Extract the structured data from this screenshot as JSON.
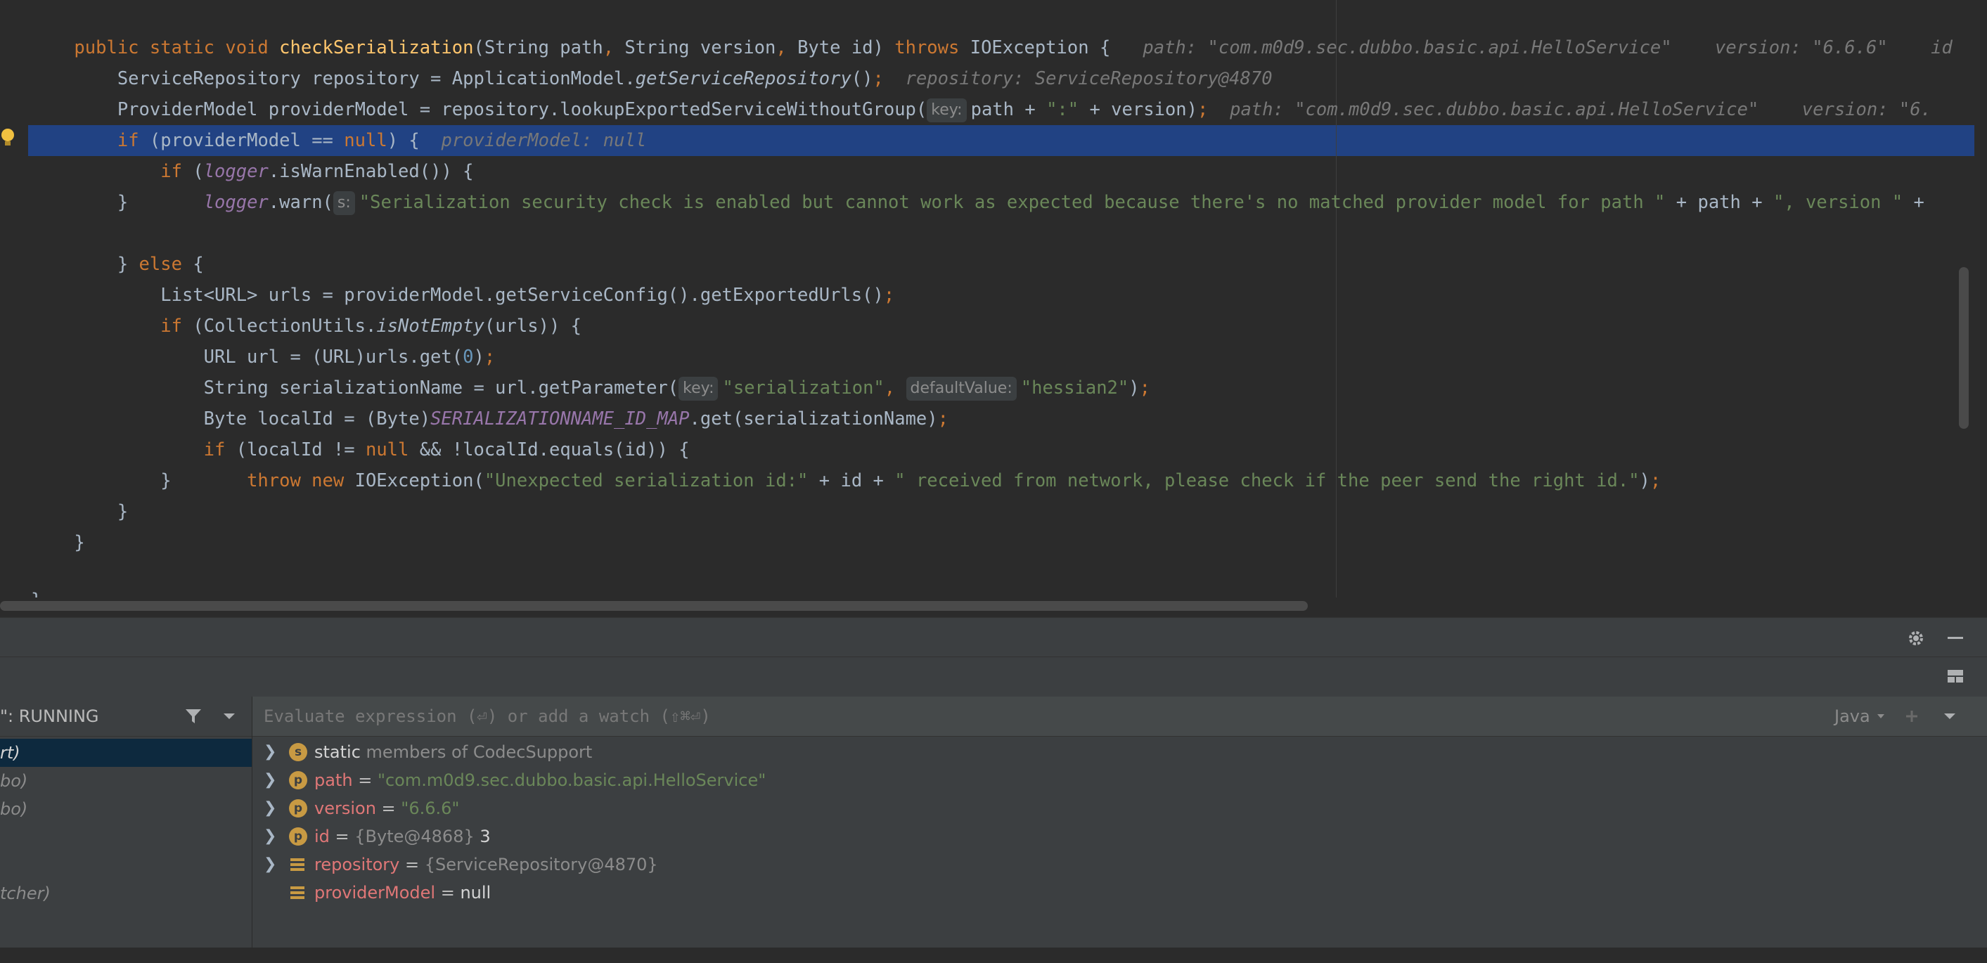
{
  "editor": {
    "lines": [
      {
        "id": "l1"
      },
      {
        "id": "l2"
      }
    ],
    "code": {
      "l1_a": "public static void ",
      "l1_fn": "checkSerialization",
      "l1_b": "(String path",
      "l1_c": ", ",
      "l1_d": "String version",
      "l1_e": ", ",
      "l1_f": "Byte id) ",
      "l1_g": "throws ",
      "l1_h": "IOException {",
      "l1_hint": "path: \"com.m0d9.sec.dubbo.basic.api.HelloService\"    version: \"6.6.6\"    id",
      "l2_a": "    ServiceRepository repository = ApplicationModel.",
      "l2_b": "getServiceRepository",
      "l2_c": "()",
      "l2_d": ";",
      "l2_hint": "repository: ServiceRepository@4870",
      "l3_a": "    ProviderModel providerModel = repository.lookupExportedServiceWithoutGroup(",
      "l3_key": "key:",
      "l3_b": "path + ",
      "l3_c": "\":\"",
      "l3_d": " + version)",
      "l3_e": ";",
      "l3_hint": "path: \"com.m0d9.sec.dubbo.basic.api.HelloService\"    version: \"6.",
      "l4_a": "    ",
      "l4_kw": "if",
      "l4_b": " (providerModel == ",
      "l4_null": "null",
      "l4_c": ") {",
      "l4_hint": "providerModel: null",
      "l5_a": "        ",
      "l5_kw": "if",
      "l5_b": " (",
      "l5_f": "logger",
      "l5_c": ".isWarnEnabled()) {",
      "l6_a": "            ",
      "l6_f": "logger",
      "l6_b": ".warn(",
      "l6_key": "s:",
      "l6_str": "\"Serialization security check is enabled but cannot work as expected because there's no matched provider model for path \"",
      "l6_c": " + path + ",
      "l6_str2": "\", version \"",
      "l6_d": " +",
      "l7": "        }",
      "l8_a": "    } ",
      "l8_kw": "else",
      "l8_b": " {",
      "l9_a": "        List<URL> urls = providerModel.getServiceConfig().getExportedUrls()",
      "l9_b": ";",
      "l10_a": "        ",
      "l10_kw": "if",
      "l10_b": " (CollectionUtils.",
      "l10_st": "isNotEmpty",
      "l10_c": "(urls)) {",
      "l11_a": "            URL url = (URL)urls.get(",
      "l11_num": "0",
      "l11_b": ")",
      "l11_c": ";",
      "l12_a": "            String serializationName = url.getParameter(",
      "l12_key": "key:",
      "l12_str": "\"serialization\"",
      "l12_b": ", ",
      "l12_key2": "defaultValue:",
      "l12_str2": "\"hessian2\"",
      "l12_c": ")",
      "l12_d": ";",
      "l13_a": "            Byte localId = (Byte)",
      "l13_cst": "SERIALIZATIONNAME_ID_MAP",
      "l13_b": ".get(serializationName)",
      "l13_c": ";",
      "l14_a": "            ",
      "l14_kw": "if",
      "l14_b": " (localId != ",
      "l14_null": "null",
      "l14_c": " && !localId.equals(id)) {",
      "l15_a": "                ",
      "l15_kw": "throw new ",
      "l15_b": "IOException(",
      "l15_str": "\"Unexpected serialization id:\"",
      "l15_c": " + id + ",
      "l15_str2": "\" received from network, please check if the peer send the right id.\"",
      "l15_d": ")",
      "l15_e": ";",
      "l16": "            }",
      "l17": "        }",
      "l18": "    }",
      "l19": "}"
    }
  },
  "debugger": {
    "status": "\": RUNNING",
    "eval_placeholder": "Evaluate expression (⏎) or add a watch (⇧⌘⏎)",
    "language": "Java",
    "frames": [
      "rt)",
      "bo)",
      "bo)",
      "tcher)"
    ],
    "variables": [
      {
        "badge": "s",
        "name": "static",
        "rest": " members of CodecSupport",
        "value": ""
      },
      {
        "badge": "p",
        "name": "path",
        "value": "\"com.m0d9.sec.dubbo.basic.api.HelloService\""
      },
      {
        "badge": "p",
        "name": "version",
        "value": "\"6.6.6\""
      },
      {
        "badge": "p",
        "name": "id",
        "obj": "{Byte@4868}",
        "value": "3"
      },
      {
        "badge": "field",
        "name": "repository",
        "obj": "{ServiceRepository@4870}"
      },
      {
        "badge": "field",
        "name": "providerModel",
        "value": "null"
      }
    ],
    "eq": " = "
  },
  "colors": {
    "selection": "#214283",
    "badge": "#c89a43",
    "string": "#6a8759",
    "keyword": "#cc7832"
  }
}
